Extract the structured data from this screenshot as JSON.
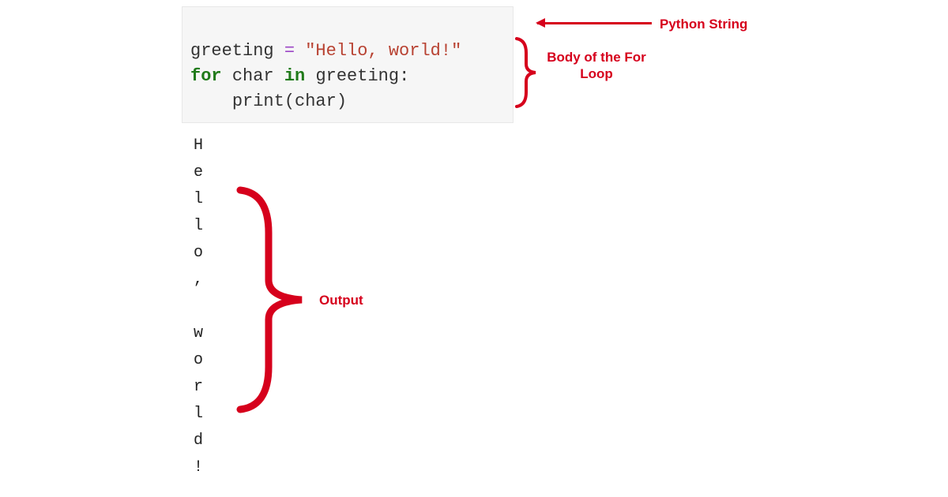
{
  "code": {
    "line1": {
      "variable": "greeting",
      "assign": " = ",
      "string": "\"Hello, world!\""
    },
    "line2": {
      "kw_for": "for",
      "sp1": " ",
      "var_char": "char",
      "sp2": " ",
      "kw_in": "in",
      "sp3": " ",
      "var_greeting": "greeting",
      "colon": ":"
    },
    "line3": {
      "indent": "    ",
      "fn": "print",
      "open": "(",
      "arg": "char",
      "close": ")"
    }
  },
  "annotations": {
    "python_string": "Python String",
    "body": "Body of the For Loop",
    "output": "Output"
  },
  "output_chars": [
    "H",
    "e",
    "l",
    "l",
    "o",
    ",",
    " ",
    "w",
    "o",
    "r",
    "l",
    "d",
    "!"
  ],
  "colors": {
    "annotation": "#d6001c",
    "code_bg": "#f6f6f6"
  }
}
